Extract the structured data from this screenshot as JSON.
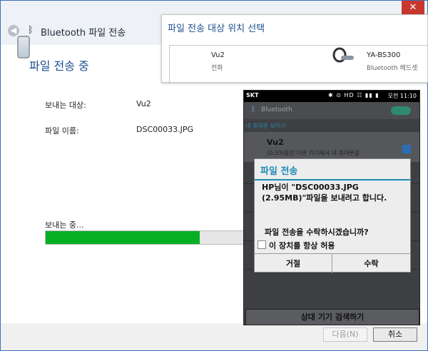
{
  "window": {
    "title": "Bluetooth 파일 전송",
    "close_label": "✕",
    "back_label": "◀",
    "heading": "파일 전송 중",
    "rows": [
      {
        "label": "보내는 대상:",
        "value": "Vu2"
      },
      {
        "label": "파일 이름:",
        "value": "DSC00033.JPG"
      }
    ],
    "progress_label": "보내는 중...",
    "progress": 0.75,
    "next_button": "다음(N)",
    "cancel_button": "취소"
  },
  "picker": {
    "title": "파일 전송 대상 위치 선택",
    "devices": [
      {
        "name": "Vu2",
        "type": "전화",
        "icon": "phone-icon"
      },
      {
        "name": "YA-BS300",
        "type": "Bluetooth 헤드셋",
        "icon": "headset-icon"
      }
    ]
  },
  "phone": {
    "status": {
      "carrier": "SKT",
      "time": "오전 11:10",
      "icons": "✱ ⊙ HD ☷ ▮▮ ▮"
    },
    "appbar_title": "Bluetooth",
    "section_label": "내 휴대폰 보이기",
    "device": {
      "name": "Vu2",
      "sub": "(0:33)동안 다른 기기에서 내 휴대폰을"
    },
    "search_button": "상대 기기 검색하기",
    "dialog": {
      "title": "파일 전송",
      "message": "HP님이 \"DSC00033.JPG (2.95MB)\"파일을 보내려고 합니다.",
      "question": "파일 전송을 수락하시겠습니까?",
      "checkbox_label": "이 장치를 항상 허용",
      "reject": "거절",
      "accept": "수락"
    }
  },
  "colors": {
    "accent": "#1d4f91",
    "progress": "#06b025",
    "dialog_accent": "#1d8bb5",
    "close": "#c7372f"
  }
}
